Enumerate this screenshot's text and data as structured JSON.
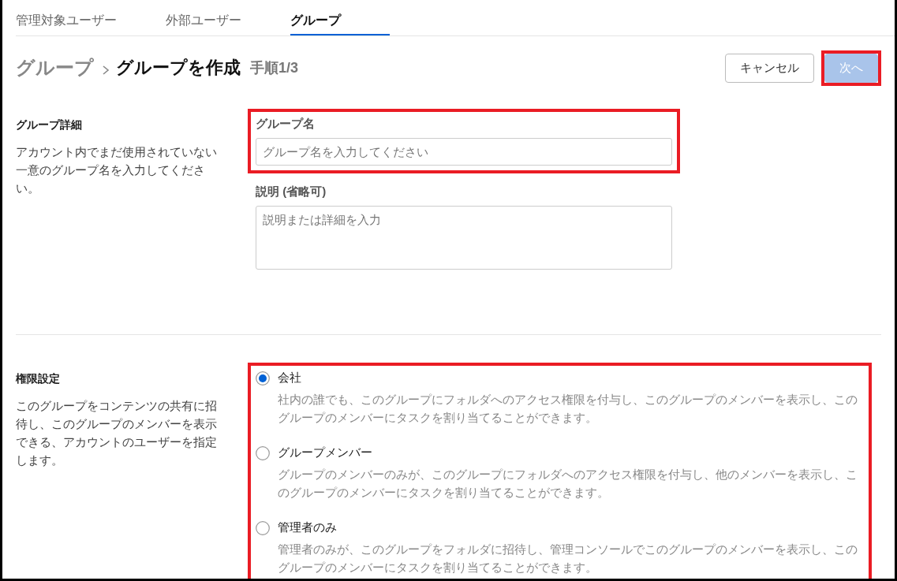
{
  "tabs": [
    {
      "label": "管理対象ユーザー",
      "selected": false
    },
    {
      "label": "外部ユーザー",
      "selected": false
    },
    {
      "label": "グループ",
      "selected": true
    }
  ],
  "header": {
    "breadcrumb_parent": "グループ",
    "title": "グループを作成",
    "step": "手順1/3",
    "buttons": [
      {
        "kind": "secondary",
        "label": "キャンセル",
        "disabled": false,
        "highlighted": false
      },
      {
        "kind": "primary",
        "label": "次へ",
        "disabled": true,
        "highlighted": true
      }
    ]
  },
  "details_section": {
    "title": "グループ詳細",
    "description": "アカウント内でまだ使用されていない一意のグループ名を入力してください。",
    "fields": [
      {
        "kind": "input",
        "label": "グループ名",
        "placeholder": "グループ名を入力してください",
        "highlighted": true
      },
      {
        "kind": "textarea",
        "label": "説明 (省略可)",
        "placeholder": "説明または詳細を入力",
        "highlighted": false
      }
    ]
  },
  "permission_section": {
    "title": "権限設定",
    "description": "このグループをコンテンツの共有に招待し、このグループのメンバーを表示できる、アカウントのユーザーを指定します。",
    "highlighted": true,
    "options": [
      {
        "label": "会社",
        "description": "社内の誰でも、このグループにフォルダへのアクセス権限を付与し、このグループのメンバーを表示し、このグループのメンバーにタスクを割り当てることができます。",
        "selected": true
      },
      {
        "label": "グループメンバー",
        "description": "グループのメンバーのみが、このグループにフォルダへのアクセス権限を付与し、他のメンバーを表示し、このグループのメンバーにタスクを割り当てることができます。",
        "selected": false
      },
      {
        "label": "管理者のみ",
        "description": "管理者のみが、このグループをフォルダに招待し、管理コンソールでこのグループのメンバーを表示し、このグループのメンバーにタスクを割り当てることができます。",
        "selected": false
      }
    ]
  }
}
